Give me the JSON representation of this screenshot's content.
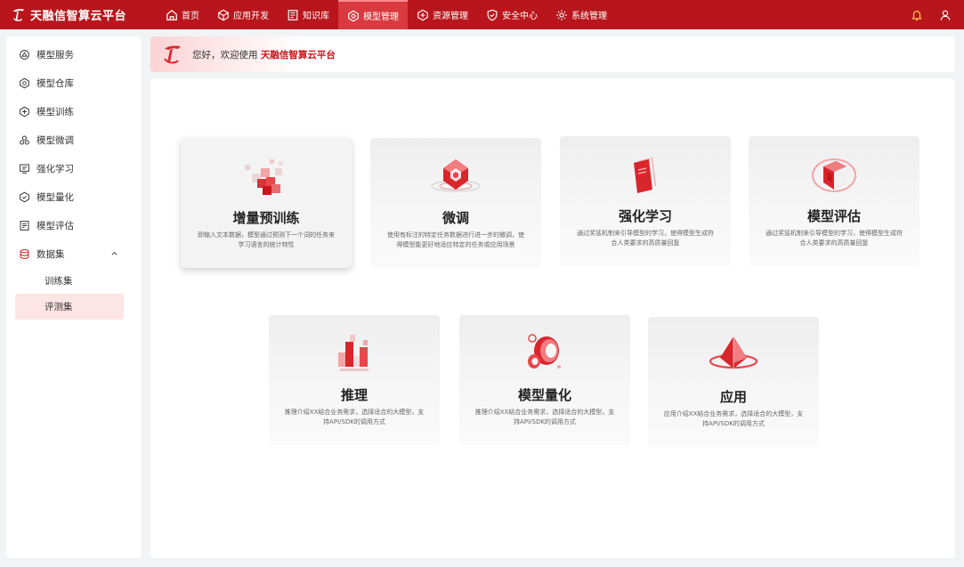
{
  "app": {
    "brand_name": "天融信智算云平台"
  },
  "nav": {
    "items": [
      {
        "label": "首页",
        "icon": "home-icon"
      },
      {
        "label": "应用开发",
        "icon": "cube-icon"
      },
      {
        "label": "知识库",
        "icon": "book-icon"
      },
      {
        "label": "模型管理",
        "icon": "model-icon",
        "active": true
      },
      {
        "label": "资源管理",
        "icon": "resource-icon"
      },
      {
        "label": "安全中心",
        "icon": "shield-icon"
      },
      {
        "label": "系统管理",
        "icon": "gear-icon"
      }
    ]
  },
  "header": {
    "icons": [
      "bell-icon",
      "user-icon"
    ]
  },
  "sidebar": {
    "items": [
      {
        "label": "模型服务",
        "icon": "service-icon"
      },
      {
        "label": "模型仓库",
        "icon": "repository-icon"
      },
      {
        "label": "模型训练",
        "icon": "training-icon"
      },
      {
        "label": "模型微调",
        "icon": "finetune-icon"
      },
      {
        "label": "强化学习",
        "icon": "reinforcement-icon"
      },
      {
        "label": "模型量化",
        "icon": "quantize-icon"
      },
      {
        "label": "模型评估",
        "icon": "evaluate-icon"
      },
      {
        "label": "数据集",
        "icon": "dataset-icon",
        "expanded": true
      }
    ],
    "sub_items": [
      {
        "label": "训练集"
      },
      {
        "label": "评测集",
        "active": true
      }
    ]
  },
  "welcome": {
    "greeting": "您好，欢迎使用",
    "brand": "天融信智算云平台"
  },
  "cards": [
    {
      "title": "增量预训练",
      "desc": "即输入文本数据，模型通过预测下一个词的任务来学习语言的统计特性",
      "active": true
    },
    {
      "title": "微调",
      "desc": "使用有标注的特定任务数据进行进一步的微调，使得模型能更好地适应特定的任务或应用场景"
    },
    {
      "title": "强化学习",
      "desc": "通过奖惩机制来引导模型的学习，使得模型生成符合人类要求的高质量回复"
    },
    {
      "title": "模型评估",
      "desc": "通过奖惩机制来引导模型的学习，使得模型生成符合人类要求的高质量回复"
    },
    {
      "title": "推理",
      "desc": "推理介绍XX结合业务需求，选择适合的大模型，支持API/SDK的调用方式"
    },
    {
      "title": "模型量化",
      "desc": "推理介绍XX结合业务需求，选择适合的大模型，支持API/SDK的调用方式"
    },
    {
      "title": "应用",
      "desc": "应用介绍XX结合业务需求，选择适合的大模型，支持API/SDK的调用方式"
    }
  ],
  "colors": {
    "brand_red": "#b8161c",
    "nav_active": "#d83a3f",
    "accent": "#c8161d",
    "sub_active_bg": "#fde4e5"
  }
}
